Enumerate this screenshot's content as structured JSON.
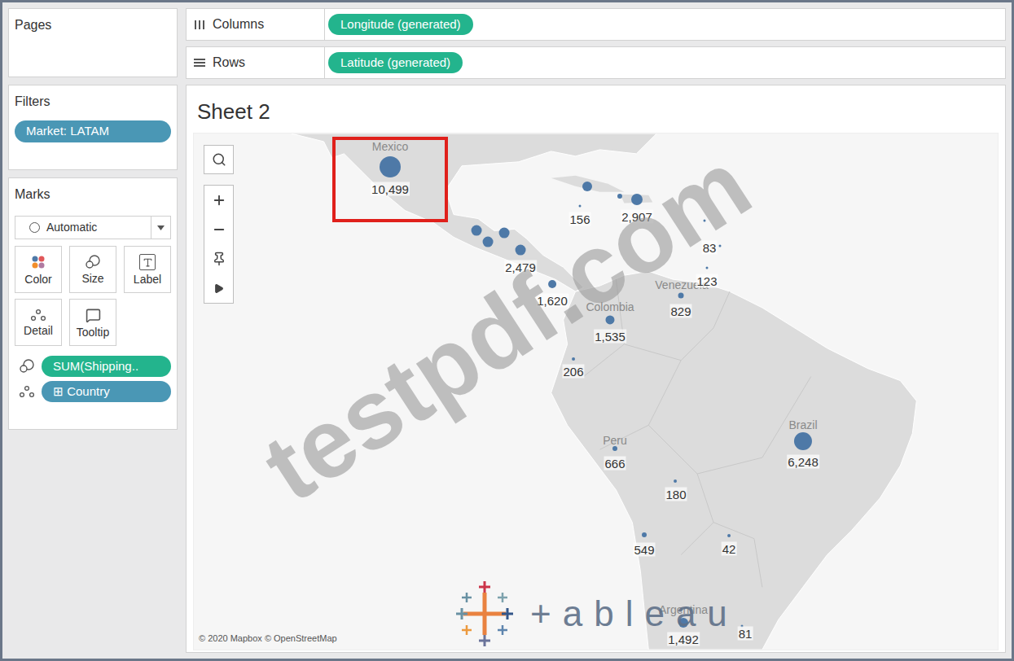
{
  "shelves": {
    "columns": {
      "label": "Columns",
      "pills": [
        {
          "label": "Longitude (generated)"
        }
      ]
    },
    "rows": {
      "label": "Rows",
      "pills": [
        {
          "label": "Latitude (generated)"
        }
      ]
    }
  },
  "sidebar": {
    "pages": {
      "title": "Pages"
    },
    "filters": {
      "title": "Filters",
      "pills": [
        {
          "label": "Market: LATAM"
        }
      ]
    },
    "marks": {
      "title": "Marks",
      "mark_type": "Automatic",
      "buttons": [
        {
          "label": "Color"
        },
        {
          "label": "Size"
        },
        {
          "label": "Label"
        },
        {
          "label": "Detail"
        },
        {
          "label": "Tooltip"
        }
      ],
      "fields": [
        {
          "label": "SUM(Shipping..",
          "kind": "size",
          "color": "#23b48d"
        },
        {
          "label": "⊞ Country",
          "kind": "detail",
          "color": "#4a97b5"
        }
      ]
    }
  },
  "sheet": {
    "title": "Sheet 2"
  },
  "map": {
    "country_labels": [
      "Mexico",
      "Venezuela",
      "Colombia",
      "Peru",
      "Brazil",
      "Argentina"
    ],
    "points": [
      {
        "label": "10,499",
        "level": 1
      },
      {
        "level": 0.39
      },
      {
        "label": "156",
        "level": 0
      },
      {
        "level": 0.13
      },
      {
        "label": "2,907",
        "level": 0.48
      },
      {
        "level": 0.43
      },
      {
        "level": 0.43
      },
      {
        "level": 0.43
      },
      {
        "label": "2,479",
        "level": 0.43
      },
      {
        "label": "1,620",
        "level": 0.3
      },
      {
        "level": 0
      },
      {
        "label": "83",
        "level": 0
      },
      {
        "label": "123",
        "level": 0
      },
      {
        "label": "829",
        "level": 0.17
      },
      {
        "label": "1,535",
        "level": 0.35
      },
      {
        "label": "206",
        "level": 0.04
      },
      {
        "label": "666",
        "level": 0.13
      },
      {
        "label": "180",
        "level": 0.04
      },
      {
        "label": "549",
        "level": 0.13
      },
      {
        "label": "42",
        "level": 0.04
      },
      {
        "label": "6,248",
        "level": 0.83
      },
      {
        "label": "1,492",
        "level": 0.39
      },
      {
        "label": "81",
        "level": 0
      }
    ],
    "attribution": "© 2020 Mapbox © OpenStreetMap"
  },
  "watermark": "testpdf.com",
  "logo": {
    "wordmark": "+ableau"
  }
}
